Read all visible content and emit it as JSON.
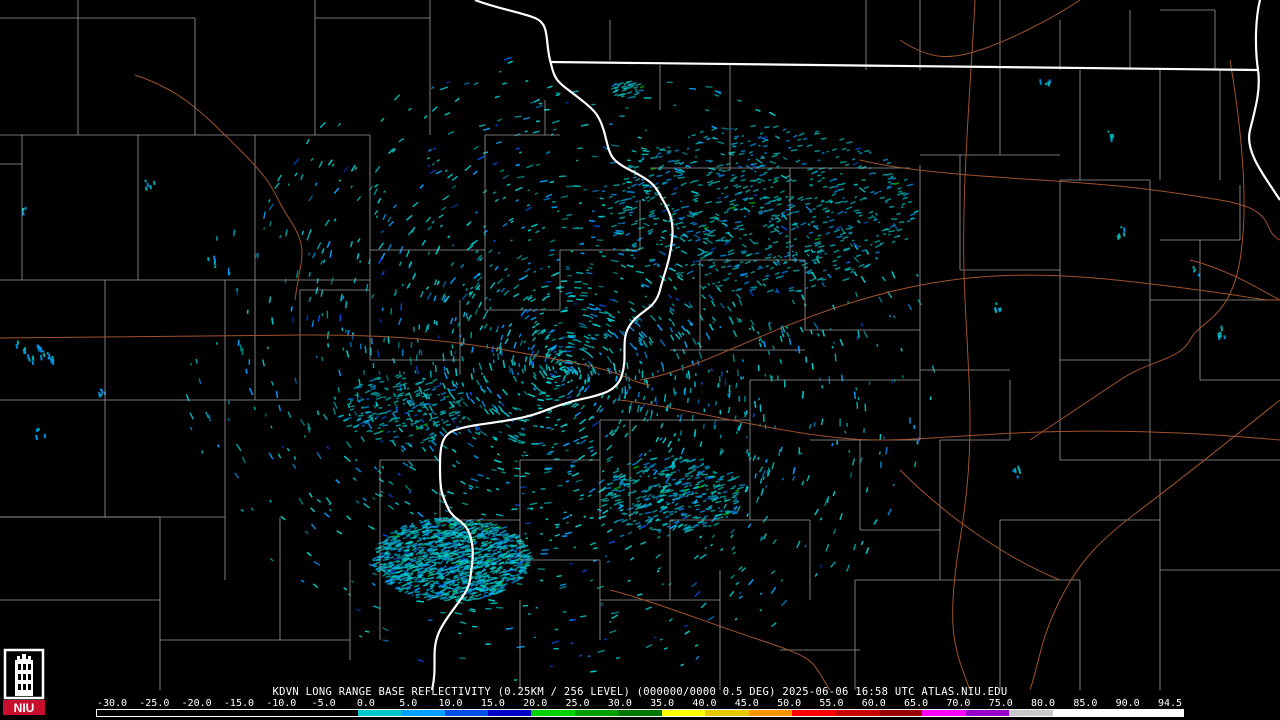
{
  "title": "KDVN LONG RANGE BASE REFLECTIVITY (0.25KM / 256 LEVEL) (000000/0000 0.5 DEG) 2025-06-06 16:58 UTC  ATLAS.NIU.EDU",
  "logo_text": "NIU",
  "scale": {
    "labels": [
      "-30.0",
      "-25.0",
      "-20.0",
      "-15.0",
      "-10.0",
      "-5.0",
      "0.0",
      "5.0",
      "10.0",
      "15.0",
      "20.0",
      "25.0",
      "30.0",
      "35.0",
      "40.0",
      "45.0",
      "50.0",
      "55.0",
      "60.0",
      "65.0",
      "70.0",
      "75.0",
      "80.0",
      "85.0",
      "90.0",
      "94.5"
    ],
    "colors": [
      "#000000",
      "#000000",
      "#000000",
      "#000000",
      "#000000",
      "#000000",
      "#00c8c8",
      "#00a0ff",
      "#0050e6",
      "#0000c8",
      "#00d200",
      "#00a000",
      "#007800",
      "#ffff00",
      "#e6c800",
      "#ff9600",
      "#ff0000",
      "#c80000",
      "#960000",
      "#ff00ff",
      "#9600c8",
      "#c8c8c8",
      "#ffffff",
      "#ffffff",
      "#ffffff"
    ]
  },
  "map_colors": {
    "background": "#000000",
    "state_border": "#ffffff",
    "county_line": "#9a9a9a",
    "highway": "#a0522d",
    "echo_light": "#00c8c8",
    "echo_mid": "#00a0ff",
    "echo_dark": "#0050e6",
    "echo_green": "#00d200"
  }
}
